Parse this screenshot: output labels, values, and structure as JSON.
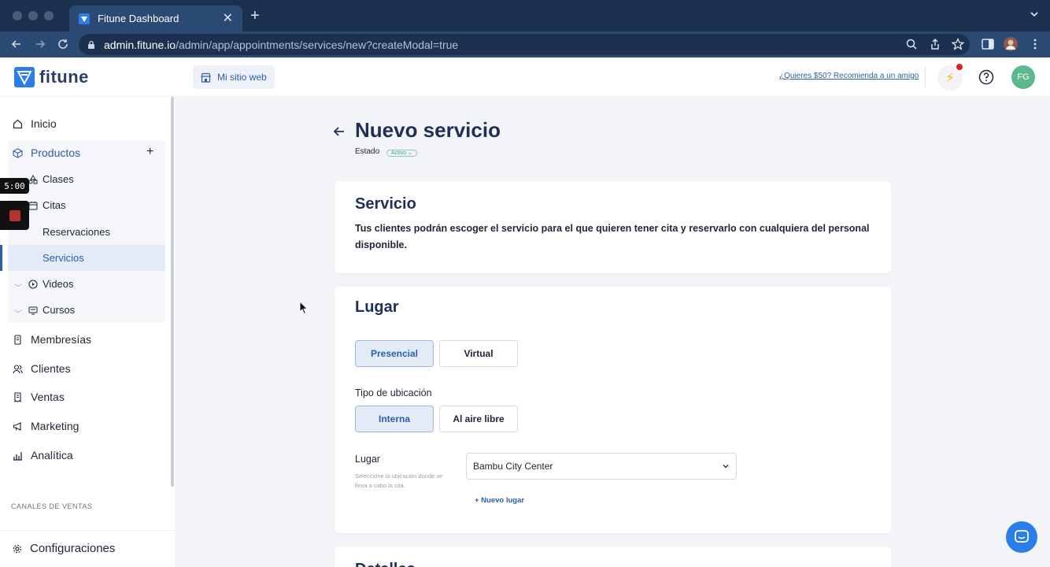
{
  "browser": {
    "tab_title": "Fitune Dashboard",
    "url_host": "admin.fitune.io",
    "url_path": "/admin/app/appointments/services/new?createModal=true"
  },
  "header": {
    "brand": "fitune",
    "site_button": "Mi sitio web",
    "referral": "¿Quieres $50? Recomienda a un amigo",
    "avatar_initials": "FG"
  },
  "sidebar": {
    "inicio": "Inicio",
    "productos": "Productos",
    "clases": "Clases",
    "citas": "Citas",
    "reservaciones": "Reservaciones",
    "servicios": "Servicios",
    "videos": "Videos",
    "cursos": "Cursos",
    "membresias": "Membresías",
    "clientes": "Clientes",
    "ventas": "Ventas",
    "marketing": "Marketing",
    "analitica": "Analítica",
    "section_channels": "CANALES DE VENTAS",
    "config": "Configuraciones"
  },
  "overlay": {
    "timer": "5:00"
  },
  "page": {
    "title": "Nuevo servicio",
    "estado_label": "Estado",
    "estado_value": "Activo"
  },
  "servicio_card": {
    "title": "Servicio",
    "text": "Tus clientes podrán escoger el servicio para el que quieren tener cita y reservarlo con cualquiera del personal disponible."
  },
  "lugar_card": {
    "title": "Lugar",
    "mode_options": [
      "Presencial",
      "Virtual"
    ],
    "tipo_label": "Tipo de ubicación",
    "tipo_options": [
      "Interna",
      "Al aire libre"
    ],
    "lugar_label": "Lugar",
    "lugar_help": "Seleccione la ubicación donde se lleva a cabo la cita.",
    "lugar_value": "Bambu City Center",
    "new_place": "+ Nuevo lugar"
  },
  "detalles_card": {
    "title": "Detalles"
  },
  "colors": {
    "brand_blue": "#2b5eaa",
    "title_navy": "#1f2f55",
    "avatar_green": "#5cb88f"
  }
}
